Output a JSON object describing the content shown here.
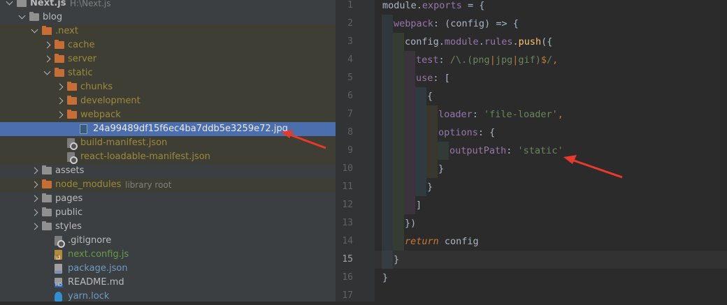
{
  "project_tree": {
    "rows": [
      {
        "label": "Next.js",
        "hint": "H:\\Next.js",
        "kind": "folder-grey",
        "expanded": true,
        "indent": 0,
        "style": "bold"
      },
      {
        "label": "blog",
        "kind": "folder-grey",
        "expanded": true,
        "indent": 1,
        "style": "def"
      },
      {
        "label": ".next",
        "kind": "folder-orange",
        "expanded": true,
        "indent": 2,
        "style": "ign",
        "bg": "ignored"
      },
      {
        "label": "cache",
        "kind": "folder-orange",
        "expanded": false,
        "indent": 3,
        "style": "ign",
        "bg": "ignored"
      },
      {
        "label": "server",
        "kind": "folder-orange",
        "expanded": false,
        "indent": 3,
        "style": "ign",
        "bg": "ignored"
      },
      {
        "label": "static",
        "kind": "folder-orange",
        "expanded": true,
        "indent": 3,
        "style": "ign",
        "bg": "ignored"
      },
      {
        "label": "chunks",
        "kind": "folder-orange",
        "expanded": false,
        "indent": 4,
        "style": "ign",
        "bg": "ignored"
      },
      {
        "label": "development",
        "kind": "folder-orange",
        "expanded": false,
        "indent": 4,
        "style": "ign",
        "bg": "ignored"
      },
      {
        "label": "webpack",
        "kind": "folder-orange",
        "expanded": false,
        "indent": 4,
        "style": "ign",
        "bg": "ignored"
      },
      {
        "label": "24a99489df15f6ec4ba7ddb5e3259e72.jpg",
        "kind": "file-img",
        "indent": 5,
        "style": "sel",
        "bg": "selected"
      },
      {
        "label": "build-manifest.json",
        "kind": "file-gear",
        "indent": 4,
        "style": "ign",
        "bg": "ignored"
      },
      {
        "label": "react-loadable-manifest.json",
        "kind": "file-gear",
        "indent": 4,
        "style": "ign",
        "bg": "ignored"
      },
      {
        "label": "assets",
        "kind": "folder-grey",
        "expanded": false,
        "indent": 2,
        "style": "def"
      },
      {
        "label": "node_modules",
        "hint": "library root",
        "kind": "folder-orange",
        "expanded": false,
        "indent": 2,
        "style": "ign",
        "bg": "ignored"
      },
      {
        "label": "pages",
        "kind": "folder-grey",
        "expanded": false,
        "indent": 2,
        "style": "def"
      },
      {
        "label": "public",
        "kind": "folder-grey",
        "expanded": false,
        "indent": 2,
        "style": "def"
      },
      {
        "label": "styles",
        "kind": "folder-grey",
        "expanded": false,
        "indent": 2,
        "style": "def"
      },
      {
        "label": ".gitignore",
        "kind": "file-gear",
        "indent": 3,
        "style": "def"
      },
      {
        "label": "next.config.js",
        "kind": "file-js",
        "indent": 3,
        "style": "js"
      },
      {
        "label": "package.json",
        "kind": "file-json",
        "indent": 3,
        "style": "json"
      },
      {
        "label": "README.md",
        "kind": "file-md",
        "indent": 3,
        "style": "def"
      },
      {
        "label": "yarn.lock",
        "kind": "file-lock",
        "indent": 3,
        "style": "json"
      }
    ]
  },
  "editor": {
    "current_line": 15,
    "lines": [
      {
        "n": "1",
        "depth": 0,
        "tokens": [
          [
            "module",
            "plain"
          ],
          [
            ".",
            "plain"
          ],
          [
            "exports",
            "prop"
          ],
          [
            " = {",
            "plain"
          ]
        ]
      },
      {
        "n": "2",
        "depth": 1,
        "tokens": [
          [
            "webpack",
            "fn2"
          ],
          [
            ": (config) ",
            "plain"
          ],
          [
            "=>",
            "plain"
          ],
          [
            " {",
            "plain"
          ]
        ]
      },
      {
        "n": "3",
        "depth": 2,
        "tokens": [
          [
            "config",
            "plain"
          ],
          [
            ".",
            "plain"
          ],
          [
            "module",
            "prop"
          ],
          [
            ".",
            "plain"
          ],
          [
            "rules",
            "prop"
          ],
          [
            ".",
            "plain"
          ],
          [
            "push",
            "fn"
          ],
          [
            "({",
            "plain"
          ]
        ]
      },
      {
        "n": "4",
        "depth": 3,
        "tokens": [
          [
            "test",
            "prop"
          ],
          [
            ": ",
            "plain"
          ],
          [
            "/\\.(png",
            "re"
          ],
          [
            "|",
            "rex"
          ],
          [
            "jpg",
            "re"
          ],
          [
            "|",
            "rex"
          ],
          [
            "gif)",
            "re"
          ],
          [
            "$",
            "rex"
          ],
          [
            "/",
            "re"
          ],
          [
            ",",
            "key"
          ]
        ]
      },
      {
        "n": "5",
        "depth": 3,
        "tokens": [
          [
            "use",
            "prop"
          ],
          [
            ": [",
            "plain"
          ]
        ]
      },
      {
        "n": "6",
        "depth": 4,
        "tokens": [
          [
            "{",
            "plain"
          ]
        ]
      },
      {
        "n": "7",
        "depth": 5,
        "tokens": [
          [
            "loader",
            "prop"
          ],
          [
            ": ",
            "plain"
          ],
          [
            "'file-loader'",
            "str"
          ],
          [
            ",",
            "key"
          ]
        ]
      },
      {
        "n": "8",
        "depth": 5,
        "tokens": [
          [
            "options",
            "prop"
          ],
          [
            ": {",
            "plain"
          ]
        ]
      },
      {
        "n": "9",
        "depth": 6,
        "tokens": [
          [
            "outputPath",
            "prop"
          ],
          [
            ": ",
            "plain"
          ],
          [
            "'static'",
            "str"
          ]
        ]
      },
      {
        "n": "10",
        "depth": 5,
        "tokens": [
          [
            "}",
            "plain"
          ]
        ]
      },
      {
        "n": "11",
        "depth": 4,
        "tokens": [
          [
            "}",
            "plain"
          ]
        ]
      },
      {
        "n": "12",
        "depth": 3,
        "tokens": [
          [
            "]",
            "plain"
          ]
        ]
      },
      {
        "n": "13",
        "depth": 2,
        "tokens": [
          [
            "})",
            "plain"
          ]
        ]
      },
      {
        "n": "14",
        "depth": 2,
        "tokens": [
          [
            "return",
            "kw"
          ],
          [
            " config",
            "plain"
          ]
        ]
      },
      {
        "n": "15",
        "depth": 1,
        "tokens": [
          [
            "}",
            "plain"
          ]
        ]
      },
      {
        "n": "16",
        "depth": 0,
        "tokens": [
          [
            "}",
            "plain"
          ]
        ]
      },
      {
        "n": "17",
        "depth": 0,
        "tokens": []
      }
    ]
  },
  "annotations": {
    "arrow_color": "#e8392b"
  }
}
